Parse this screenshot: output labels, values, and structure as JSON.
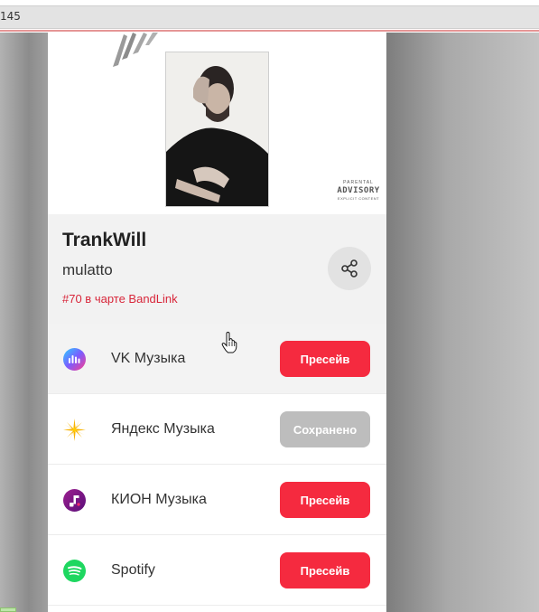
{
  "browser": {
    "url_fragment": "145"
  },
  "release": {
    "title": "TrankWill",
    "artist": "mulatto",
    "chart_text": "#70 в чарте BandLink",
    "advisory_top": "PARENTAL",
    "advisory_main": "ADVISORY",
    "advisory_bottom": "EXPLICIT CONTENT"
  },
  "colors": {
    "accent_red": "#f52a3f",
    "chart_red": "#d8263a",
    "saved_gray": "#bdbdbd"
  },
  "services": [
    {
      "name": "VK Музыка",
      "icon": "vk-music-icon",
      "button": "Пресейв",
      "state": "presave"
    },
    {
      "name": "Яндекс Музыка",
      "icon": "yandex-music-icon",
      "button": "Сохранено",
      "state": "saved"
    },
    {
      "name": "КИОН Музыка",
      "icon": "kion-music-icon",
      "button": "Пресейв",
      "state": "presave"
    },
    {
      "name": "Spotify",
      "icon": "spotify-icon",
      "button": "Пресейв",
      "state": "presave"
    }
  ]
}
